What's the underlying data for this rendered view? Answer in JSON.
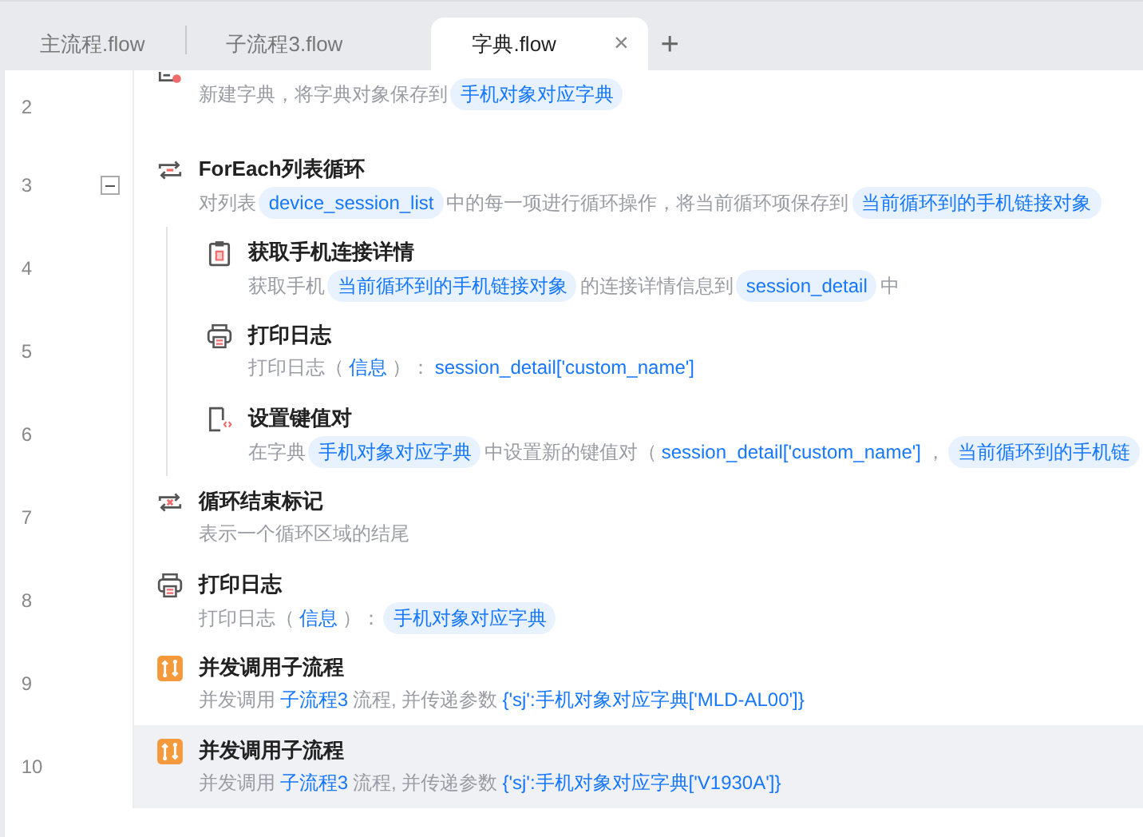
{
  "tabs": [
    {
      "label": "主流程.flow",
      "selected": false
    },
    {
      "label": "子流程3.flow",
      "selected": false
    },
    {
      "label": "字典.flow",
      "selected": true
    }
  ],
  "add_tab": "+",
  "close_tab": "×",
  "steps": [
    {
      "line": "2",
      "kind": "dict-new",
      "selected": false,
      "desc": [
        {
          "kind": "plain",
          "text": "新建字典，将字典对象保存到"
        },
        {
          "kind": "chip",
          "text": "手机对象对应字典"
        }
      ]
    },
    {
      "line": "3",
      "kind": "loop",
      "title": "ForEach列表循环",
      "expanded": true,
      "selected": false,
      "desc": [
        {
          "kind": "plain",
          "text": "对列表"
        },
        {
          "kind": "chip",
          "text": "device_session_list"
        },
        {
          "kind": "plain",
          "text": "中的每一项进行循环操作，将当前循环项保存到"
        },
        {
          "kind": "chip",
          "text": "当前循环到的手机链接对象"
        }
      ],
      "children": [
        {
          "line": "4",
          "kind": "clipboard",
          "title": "获取手机连接详情",
          "selected": false,
          "desc": [
            {
              "kind": "plain",
              "text": "获取手机"
            },
            {
              "kind": "chip",
              "text": "当前循环到的手机链接对象"
            },
            {
              "kind": "plain",
              "text": "的连接详情信息到"
            },
            {
              "kind": "chip",
              "text": "session_detail"
            },
            {
              "kind": "plain",
              "text": "中"
            }
          ]
        },
        {
          "line": "5",
          "kind": "printer",
          "title": "打印日志",
          "selected": false,
          "desc": [
            {
              "kind": "plain",
              "text": "打印日志（"
            },
            {
              "kind": "link",
              "text": "信息"
            },
            {
              "kind": "plain",
              "text": "）："
            },
            {
              "kind": "link",
              "text": "session_detail['custom_name']"
            }
          ]
        },
        {
          "line": "6",
          "kind": "dict-set",
          "title": "设置键值对",
          "selected": false,
          "desc": [
            {
              "kind": "plain",
              "text": "在字典"
            },
            {
              "kind": "chip",
              "text": "手机对象对应字典"
            },
            {
              "kind": "plain",
              "text": "中设置新的键值对（"
            },
            {
              "kind": "link",
              "text": "session_detail['custom_name']"
            },
            {
              "kind": "plain",
              "text": "，"
            },
            {
              "kind": "chip",
              "text": "当前循环到的手机链"
            }
          ]
        }
      ]
    },
    {
      "line": "7",
      "kind": "loop-end",
      "title": "循环结束标记",
      "selected": false,
      "desc": [
        {
          "kind": "plain",
          "text": "表示一个循环区域的结尾"
        }
      ]
    },
    {
      "line": "8",
      "kind": "printer",
      "title": "打印日志",
      "selected": false,
      "desc": [
        {
          "kind": "plain",
          "text": "打印日志（"
        },
        {
          "kind": "link",
          "text": "信息"
        },
        {
          "kind": "plain",
          "text": "）："
        },
        {
          "kind": "chip",
          "text": "手机对象对应字典"
        }
      ]
    },
    {
      "line": "9",
      "kind": "subflow",
      "title": "并发调用子流程",
      "selected": false,
      "desc": [
        {
          "kind": "plain",
          "text": "并发调用"
        },
        {
          "kind": "link",
          "text": "子流程3"
        },
        {
          "kind": "plain",
          "text": "流程, 并传递参数"
        },
        {
          "kind": "link",
          "text": "{'sj':手机对象对应字典['MLD-AL00']}"
        }
      ]
    },
    {
      "line": "10",
      "kind": "subflow",
      "title": "并发调用子流程",
      "selected": true,
      "desc": [
        {
          "kind": "plain",
          "text": "并发调用"
        },
        {
          "kind": "link",
          "text": "子流程3"
        },
        {
          "kind": "plain",
          "text": "流程, 并传递参数"
        },
        {
          "kind": "link",
          "text": "{'sj':手机对象对应字典['V1930A']}"
        }
      ]
    }
  ]
}
